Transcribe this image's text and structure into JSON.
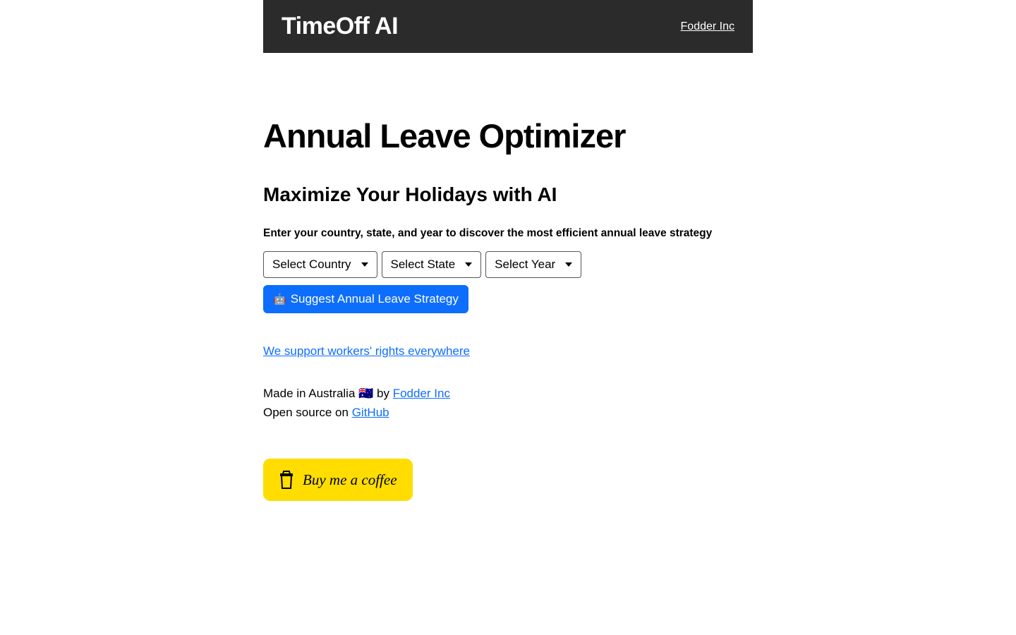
{
  "header": {
    "logo": "TimeOff AI",
    "link": "Fodder Inc"
  },
  "main": {
    "title": "Annual Leave Optimizer",
    "subtitle": "Maximize Your Holidays with AI",
    "instructions": "Enter your country, state, and year to discover the most efficient annual leave strategy",
    "dropdowns": {
      "country": "Select Country",
      "state": "Select State",
      "year": "Select Year"
    },
    "submit": "Suggest Annual Leave Strategy",
    "support_link": "We support workers' rights everywhere",
    "footer": {
      "madein_prefix": "Made in Australia 🇦🇺 by ",
      "madein_link": "Fodder Inc",
      "opensource_prefix": "Open source on ",
      "opensource_link": "GitHub"
    },
    "bmc": "Buy me a coffee"
  }
}
